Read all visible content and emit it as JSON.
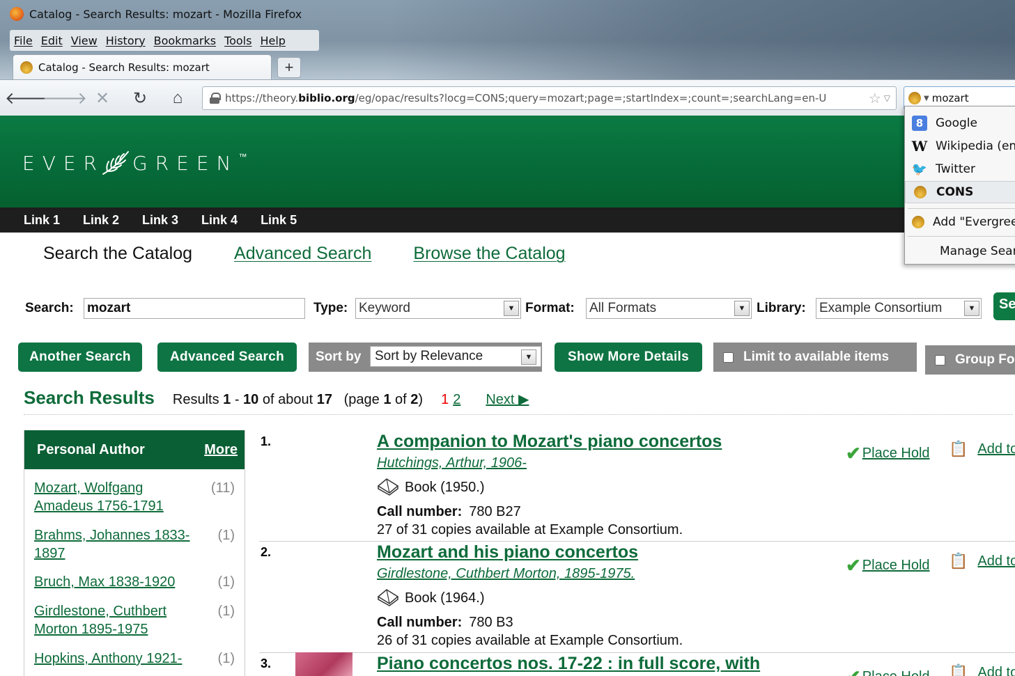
{
  "window": {
    "title": "Catalog - Search Results: mozart - Mozilla Firefox"
  },
  "menubar": [
    "File",
    "Edit",
    "View",
    "History",
    "Bookmarks",
    "Tools",
    "Help"
  ],
  "tab": {
    "label": "Catalog - Search Results: mozart",
    "new_tab": "+"
  },
  "urlbar": {
    "prefix": "https://theory.",
    "domain": "biblio.org",
    "rest": "/eg/opac/results?locg=CONS;query=mozart;page=;startIndex=;count=;searchLang=en-U"
  },
  "search_engine_box": {
    "value": "mozart"
  },
  "engine_menu": {
    "items": [
      "Google",
      "Wikipedia (en)",
      "Twitter",
      "CONS"
    ],
    "selected": "CONS",
    "add": "Add \"Evergreen\"",
    "manage": "Manage Search Engines..."
  },
  "logo": {
    "text_left": "EVER",
    "text_right": "GREEN",
    "tm": "™"
  },
  "linkbar": [
    "Link 1",
    "Link 2",
    "Link 3",
    "Link 4",
    "Link 5"
  ],
  "search_tabs": {
    "active": "Search the Catalog",
    "advanced": "Advanced Search",
    "browse": "Browse the Catalog"
  },
  "search_form": {
    "search_label": "Search:",
    "search_value": "mozart",
    "type_label": "Type:",
    "type_value": "Keyword",
    "format_label": "Format:",
    "format_value": "All Formats",
    "library_label": "Library:",
    "library_value": "Example Consortium",
    "go_label": "Search"
  },
  "toolbar": {
    "another_search": "Another Search",
    "advanced_search": "Advanced Search",
    "sort_label": "Sort by",
    "sort_value": "Sort by Relevance",
    "show_more": "Show More Details",
    "limit_available": "Limit to available items",
    "group_formats": "Group Formats and Editions"
  },
  "results_header": {
    "title": "Search Results",
    "results_word": "Results",
    "range_start": "1",
    "range_end": "10",
    "of_about": "of about",
    "total": "17",
    "page_word": "(page",
    "page_num": "1",
    "of_word": "of",
    "page_total": "2",
    "page_close": ")",
    "current_page": "1",
    "page_2": "2",
    "next": "Next ▶"
  },
  "facets": {
    "heading": "Personal Author",
    "more": "More",
    "items": [
      {
        "name": "Mozart, Wolfgang Amadeus 1756-1791",
        "count": "(11)"
      },
      {
        "name": "Brahms, Johannes 1833-1897",
        "count": "(1)"
      },
      {
        "name": "Bruch, Max 1838-1920",
        "count": "(1)"
      },
      {
        "name": "Girdlestone, Cuthbert Morton 1895-1975",
        "count": "(1)"
      },
      {
        "name": "Hopkins, Anthony 1921-",
        "count": "(1)"
      }
    ]
  },
  "results": [
    {
      "num": "1.",
      "title": "A companion to Mozart's piano concertos",
      "author": "Hutchings, Arthur, 1906-",
      "format": "Book (1950.)",
      "call_label": "Call number:",
      "call_number": "780 B27",
      "copies": "27 of 31 copies available at Example Consortium.",
      "place_hold": "Place Hold",
      "add_to_list": "Add to my list"
    },
    {
      "num": "2.",
      "title": "Mozart and his piano concertos",
      "author": "Girdlestone, Cuthbert Morton, 1895-1975.",
      "format": "Book (1964.)",
      "call_label": "Call number:",
      "call_number": "780 B3",
      "copies": "26 of 31 copies available at Example Consortium.",
      "place_hold": "Place Hold",
      "add_to_list": "Add to my list"
    },
    {
      "num": "3.",
      "title": "Piano concertos nos. 17-22 : in full score, with",
      "place_hold": "Place Hold",
      "add_to_list": "Add to my list"
    }
  ]
}
